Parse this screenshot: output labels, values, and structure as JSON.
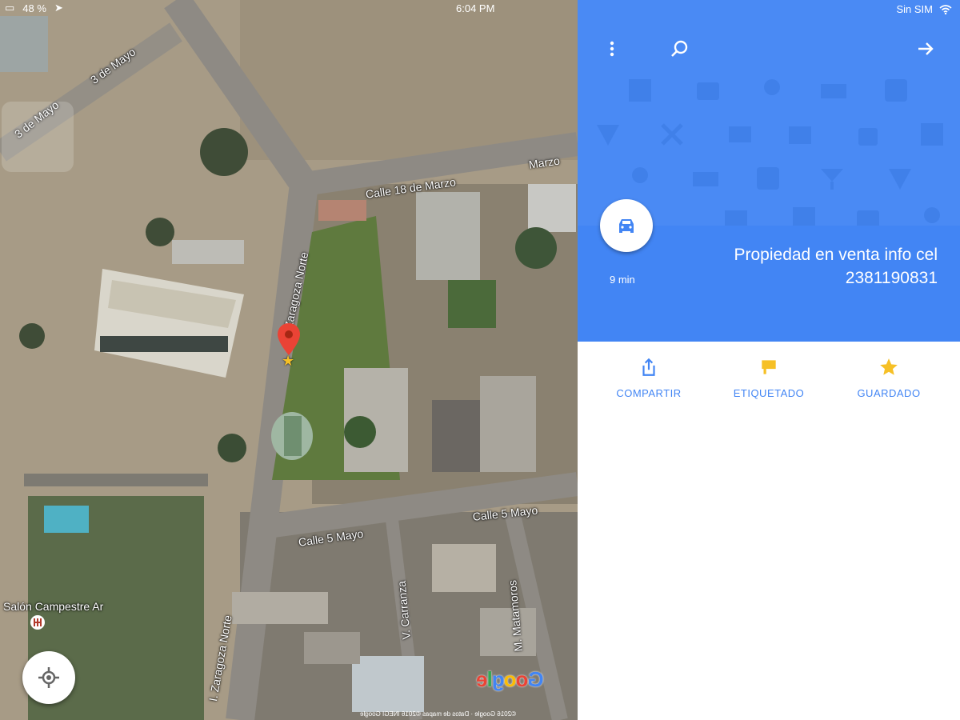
{
  "status_bar": {
    "battery": "48 %",
    "time": "6:04 PM",
    "carrier": "Sin SIM"
  },
  "map": {
    "road_labels": [
      "3 de Mayo",
      "3 de Mayo",
      "Calle 18 de Marzo",
      "Marzo",
      "I. Zaragoza Norte",
      "Calle 5 Mayo",
      "Calle 5 Mayo",
      "V. Carranza",
      "M. Matamoros",
      "I. Zaragoza Norte"
    ],
    "poi_label": "Salón Campestre Ar",
    "logo": "Google",
    "attribution": "©2016 Google · Datos de mapas ©2016 INEGI Google"
  },
  "place": {
    "title": "Propiedad en venta info cel 2381190831",
    "drive_time": "9 min"
  },
  "actions": {
    "saved": "GUARDADO",
    "labeled": "ETIQUETADO",
    "share": "COMPARTIR"
  },
  "colors": {
    "accent": "#4285f4",
    "header_bg": "#4a8af4",
    "star": "#f6c026",
    "pin": "#ea4335"
  },
  "icons": {
    "map_controls": [
      "locate-icon",
      "compass-icon"
    ],
    "panel_header": [
      "back-arrow-icon",
      "search-icon",
      "more-vert-icon"
    ],
    "actions": [
      "star-icon",
      "flag-icon",
      "share-icon"
    ],
    "drive": "car-icon"
  }
}
